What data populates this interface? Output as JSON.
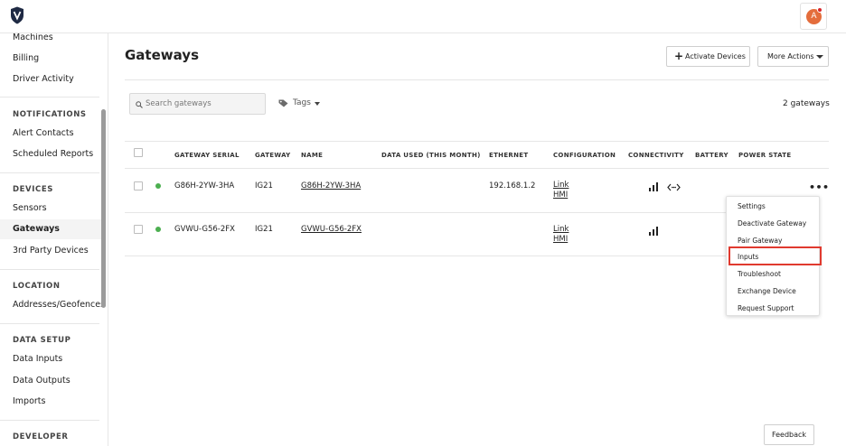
{
  "sidebar": {
    "top_items": [
      "Machines",
      "Billing",
      "Driver Activity"
    ],
    "notifications_heading": "NOTIFICATIONS",
    "notifications_items": [
      "Alert Contacts",
      "Scheduled Reports"
    ],
    "devices_heading": "DEVICES",
    "devices_items": [
      "Sensors",
      "Gateways",
      "3rd Party Devices"
    ],
    "location_heading": "LOCATION",
    "location_items": [
      "Addresses/Geofences"
    ],
    "data_setup_heading": "DATA SETUP",
    "data_setup_items": [
      "Data Inputs",
      "Data Outputs",
      "Imports"
    ],
    "developer_heading": "DEVELOPER"
  },
  "header": {
    "avatar_initial": "A"
  },
  "page": {
    "title": "Gateways",
    "activate_label": "Activate Devices",
    "more_actions_label": "More Actions",
    "search_placeholder": "Search gateways",
    "tags_label": "Tags",
    "count_label": "2 gateways"
  },
  "table": {
    "columns": [
      "GATEWAY SERIAL",
      "GATEWAY",
      "NAME",
      "DATA USED (THIS MONTH)",
      "ETHERNET",
      "CONFIGURATION",
      "CONNECTIVITY",
      "BATTERY",
      "POWER STATE"
    ],
    "rows": [
      {
        "serial": "G86H-2YW-3HA",
        "gateway": "IG21",
        "name": "G86H-2YW-3HA",
        "ethernet": "192.168.1.2",
        "config_link": "Link",
        "config_hmi": "HMI",
        "status_color": "#4caf50"
      },
      {
        "serial": "GVWU-G56-2FX",
        "gateway": "IG21",
        "name": "GVWU-G56-2FX",
        "ethernet": "",
        "config_link": "Link",
        "config_hmi": "HMI",
        "status_color": "#4caf50"
      }
    ]
  },
  "row_menu": {
    "items": [
      "Settings",
      "Deactivate Gateway",
      "Pair Gateway",
      "Inputs",
      "Troubleshoot",
      "Exchange Device",
      "Request Support"
    ],
    "highlighted": "Inputs",
    "highlight_color": "#e03a2f"
  },
  "feedback_label": "Feedback",
  "colors": {
    "accent": "#e46d3c",
    "notification_dot": "#d8262b",
    "status_online": "#4caf50"
  }
}
